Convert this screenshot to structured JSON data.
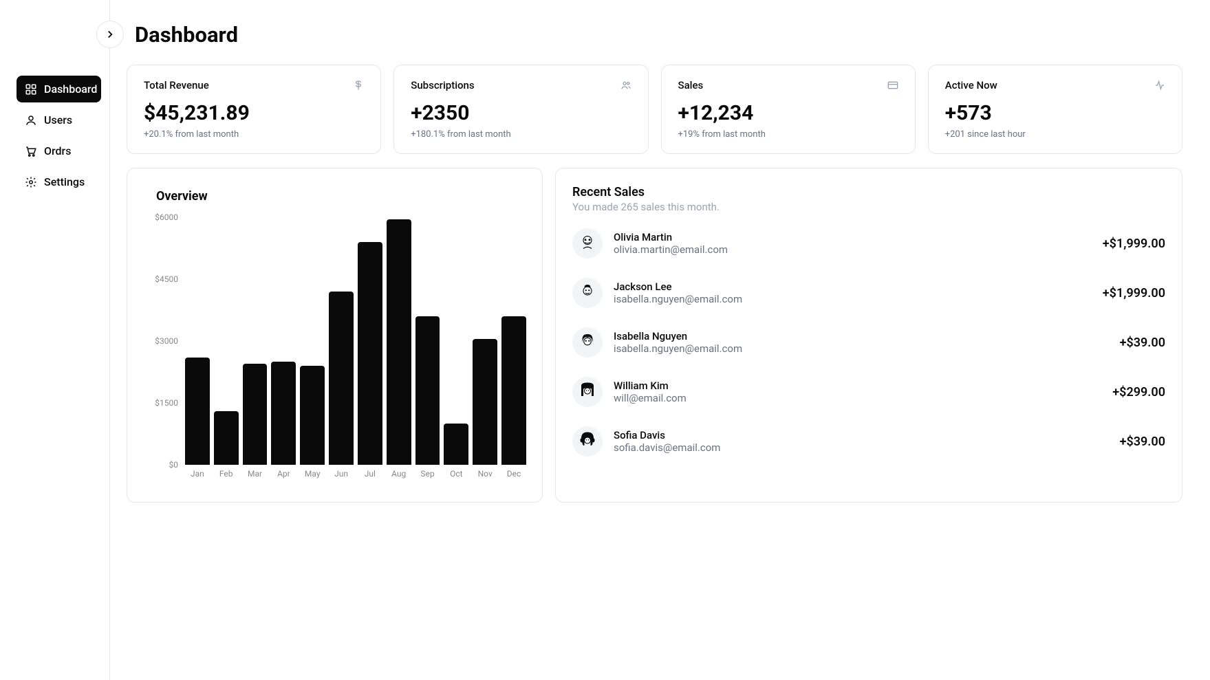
{
  "page_title": "Dashboard",
  "sidebar": {
    "items": [
      {
        "label": "Dashboard",
        "active": true
      },
      {
        "label": "Users",
        "active": false
      },
      {
        "label": "Ordrs",
        "active": false
      },
      {
        "label": "Settings",
        "active": false
      }
    ]
  },
  "cards": [
    {
      "label": "Total Revenue",
      "value": "$45,231.89",
      "sub": "+20.1% from last month"
    },
    {
      "label": "Subscriptions",
      "value": "+2350",
      "sub": "+180.1% from last month"
    },
    {
      "label": "Sales",
      "value": "+12,234",
      "sub": "+19% from last month"
    },
    {
      "label": "Active Now",
      "value": "+573",
      "sub": "+201 since last hour"
    }
  ],
  "overview": {
    "title": "Overview"
  },
  "recent_sales": {
    "title": "Recent Sales",
    "subtitle": "You made 265 sales this month.",
    "rows": [
      {
        "name": "Olivia Martin",
        "email": "olivia.martin@email.com",
        "amount": "+$1,999.00"
      },
      {
        "name": "Jackson Lee",
        "email": "isabella.nguyen@email.com",
        "amount": "+$1,999.00"
      },
      {
        "name": "Isabella Nguyen",
        "email": "isabella.nguyen@email.com",
        "amount": "+$39.00"
      },
      {
        "name": "William Kim",
        "email": "will@email.com",
        "amount": "+$299.00"
      },
      {
        "name": "Sofia Davis",
        "email": "sofia.davis@email.com",
        "amount": "+$39.00"
      }
    ]
  },
  "chart_data": {
    "type": "bar",
    "title": "Overview",
    "xlabel": "",
    "ylabel": "",
    "ylim": [
      0,
      6000
    ],
    "y_ticks": [
      "$6000",
      "$4500",
      "$3000",
      "$1500",
      "$0"
    ],
    "categories": [
      "Jan",
      "Feb",
      "Mar",
      "Apr",
      "May",
      "Jun",
      "Jul",
      "Aug",
      "Sep",
      "Oct",
      "Nov",
      "Dec"
    ],
    "values": [
      2600,
      1300,
      2450,
      2500,
      2400,
      4200,
      5400,
      5950,
      3600,
      1000,
      3050,
      3600
    ]
  }
}
